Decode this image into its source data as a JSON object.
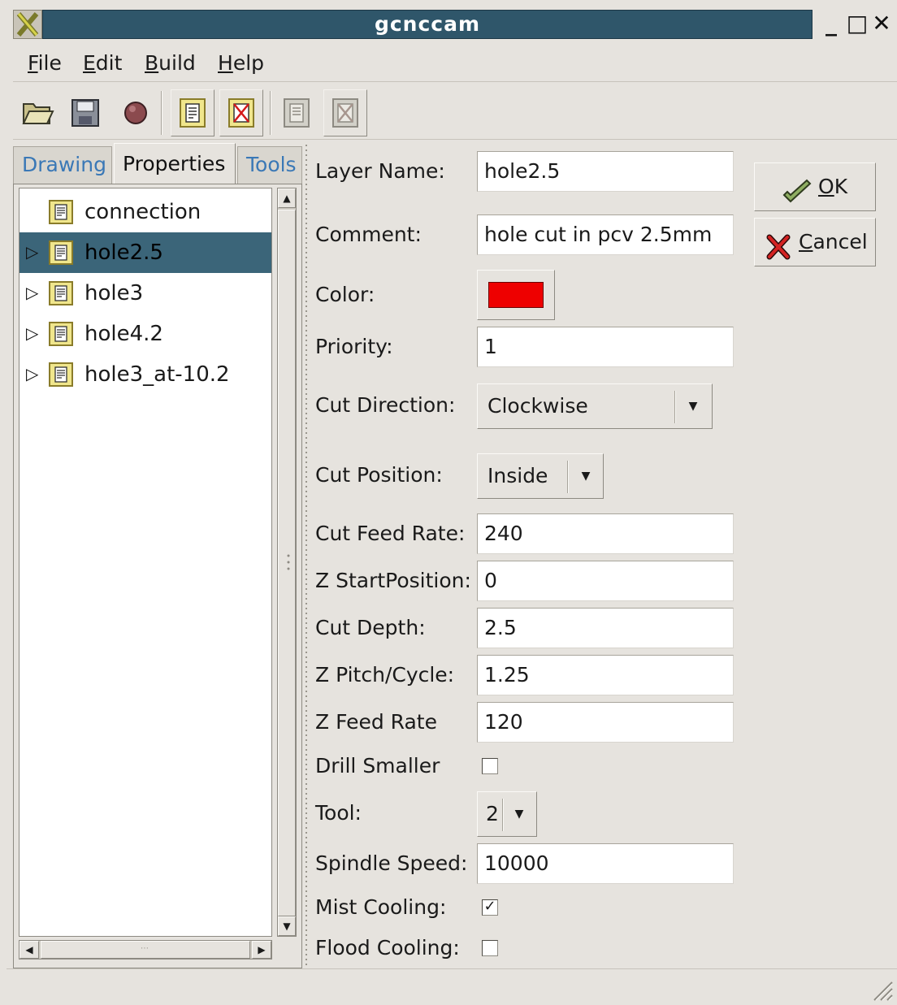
{
  "window": {
    "title": "gcnccam",
    "minimize_glyph": "_",
    "maximize_glyph": "□",
    "close_glyph": "✕"
  },
  "menu": {
    "file": {
      "accel": "F",
      "rest": "ile"
    },
    "edit": {
      "accel": "E",
      "rest": "dit"
    },
    "build": {
      "accel": "B",
      "rest": "uild"
    },
    "help": {
      "accel": "H",
      "rest": "elp"
    }
  },
  "toolbar": {
    "icons": [
      "open-folder-icon",
      "save-disk-icon",
      "record-icon",
      "layer-icon",
      "delete-layer-icon",
      "layer-disabled-icon",
      "delete-layer-disabled-icon"
    ]
  },
  "tabs": {
    "drawing": "Drawing",
    "properties": "Properties",
    "tools": "Tools",
    "active": "Properties"
  },
  "tree": {
    "items": [
      {
        "label": "connection",
        "expander": false,
        "selected": false
      },
      {
        "label": "hole2.5",
        "expander": true,
        "selected": true
      },
      {
        "label": "hole3",
        "expander": true,
        "selected": false
      },
      {
        "label": "hole4.2",
        "expander": true,
        "selected": false
      },
      {
        "label": "hole3_at-10.2",
        "expander": true,
        "selected": false
      }
    ],
    "expander_glyph": "▷",
    "scroll_up": "▲",
    "scroll_down": "▼",
    "scroll_left": "◀",
    "scroll_right": "▶",
    "hthumb_grip": "⋯"
  },
  "form": {
    "layer_name": {
      "label": "Layer Name:",
      "value": "hole2.5"
    },
    "comment": {
      "label": "Comment:",
      "value": "hole cut in pcv 2.5mm"
    },
    "color": {
      "label": "Color:",
      "value": "#ee0000"
    },
    "priority": {
      "label": "Priority:",
      "value": "1"
    },
    "cut_direction": {
      "label": "Cut Direction:",
      "value": "Clockwise"
    },
    "cut_position": {
      "label": "Cut Position:",
      "value": "Inside"
    },
    "cut_feed_rate": {
      "label": "Cut Feed Rate:",
      "value": "240"
    },
    "z_start_position": {
      "label": "Z StartPosition:",
      "value": "0"
    },
    "cut_depth": {
      "label": "Cut Depth:",
      "value": "2.5"
    },
    "z_pitch_cycle": {
      "label": "Z Pitch/Cycle:",
      "value": "1.25"
    },
    "z_feed_rate": {
      "label": "Z Feed Rate",
      "value": "120"
    },
    "drill_smaller": {
      "label": "Drill Smaller",
      "checked": false
    },
    "tool": {
      "label": "Tool:",
      "value": "2"
    },
    "spindle_speed": {
      "label": "Spindle Speed:",
      "value": "10000"
    },
    "mist_cooling": {
      "label": "Mist Cooling:",
      "checked": true
    },
    "flood_cooling": {
      "label": "Flood Cooling:",
      "checked": false
    },
    "dropdown_arrow": "▼",
    "check_mark": "✓"
  },
  "buttons": {
    "ok": {
      "accel": "O",
      "rest": "K"
    },
    "cancel": {
      "accel": "C",
      "rest": "ancel"
    }
  },
  "colors": {
    "title_bar": "#2f566a",
    "selection": "#3b6579",
    "tab_inactive_text": "#3a78b6",
    "window_bg": "#e6e3de"
  }
}
